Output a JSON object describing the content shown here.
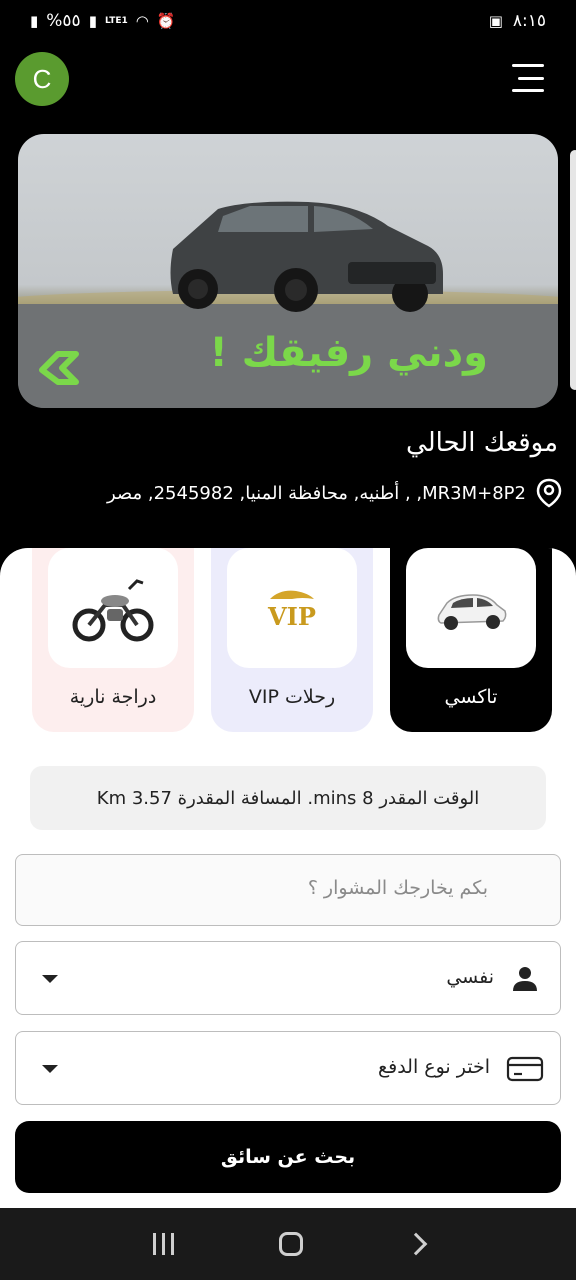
{
  "status_bar": {
    "battery": "%٥٥",
    "network": "LTE1",
    "time": "٨:١٥"
  },
  "header": {
    "avatar_letter": "C",
    "menu_icon": "hamburger-menu-icon"
  },
  "banner": {
    "slogan": "ودني رفيقك !"
  },
  "location": {
    "title": "موقعك الحالي",
    "address": "MR3M+8P2, , أطنيه, محافظة المنيا, 2545982, مصر"
  },
  "categories": [
    {
      "label": "تاكسي",
      "icon": "car-icon",
      "selected": true
    },
    {
      "label": "رحلات VIP",
      "icon": "vip-icon",
      "selected": false
    },
    {
      "label": "دراجة نارية",
      "icon": "motorcycle-icon",
      "selected": false
    }
  ],
  "trip_info": "الوقت المقدر 8 mins. المسافة المقدرة 3.57 Km",
  "form": {
    "tip_placeholder": "بكم يخارجك المشوار ؟",
    "rider_value": "نفسي",
    "payment_value": "اختر نوع الدفع"
  },
  "search_button": "بحث عن سائق",
  "colors": {
    "accent_green": "#7bd84a",
    "avatar_green": "#5a9b2f",
    "selected_category_bg": "#000000"
  }
}
